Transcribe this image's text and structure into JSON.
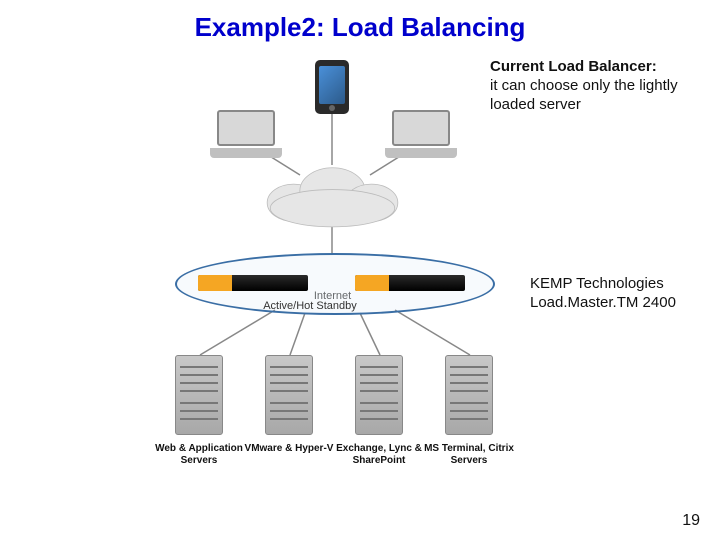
{
  "title": "Example2: Load Balancing",
  "caption_top_heading": "Current Load Balancer:",
  "caption_top_body": "it can choose only the lightly loaded server",
  "caption_mid_line1": "KEMP Technologies",
  "caption_mid_line2": "Load.Master.TM 2400",
  "diagram": {
    "cloud_label": "Internet",
    "load_balancer_cluster_label": "Active/Hot Standby",
    "server_labels": [
      "Web & Application Servers",
      "VMware & Hyper-V",
      "Exchange, Lync & SharePoint",
      "MS Terminal, Citrix Servers"
    ]
  },
  "page_number": "19"
}
